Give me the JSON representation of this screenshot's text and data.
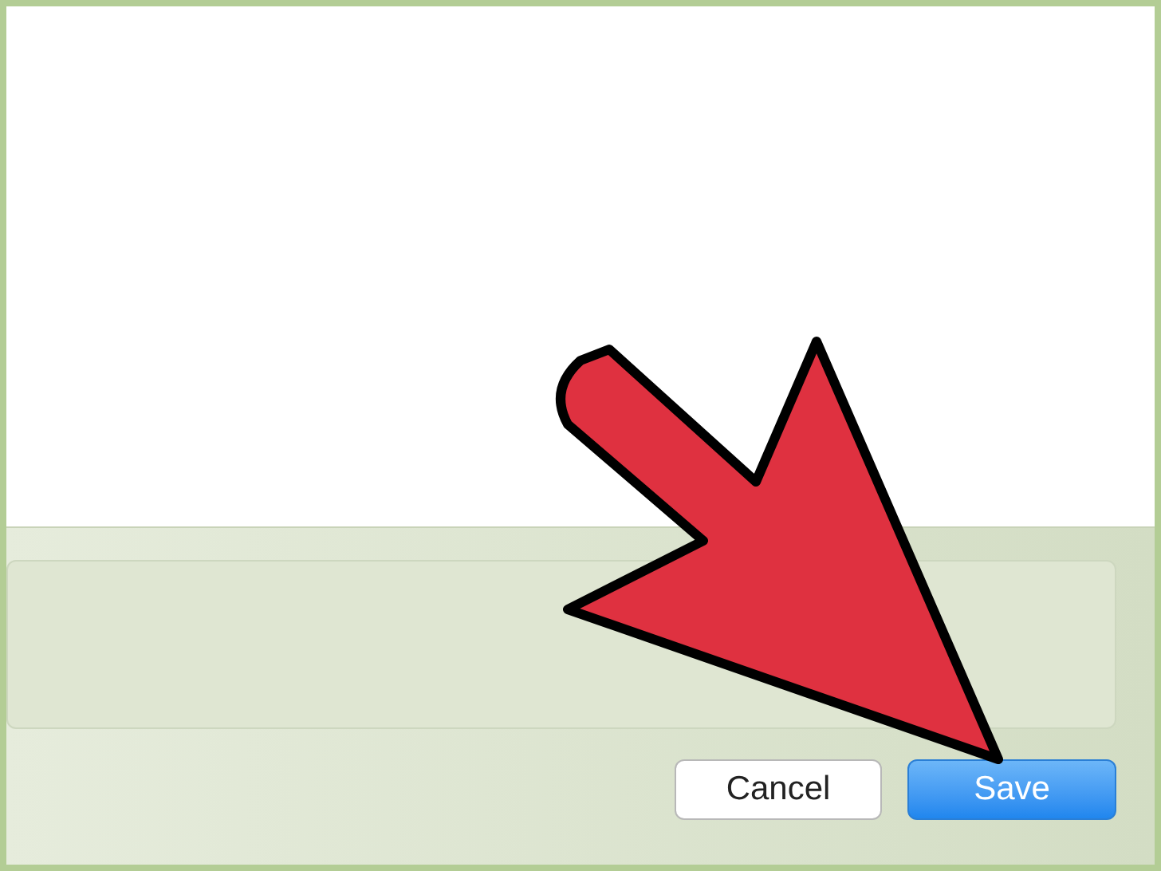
{
  "buttons": [
    {
      "label": "Cancel",
      "kind": "secondary"
    },
    {
      "label": "Save",
      "kind": "primary"
    }
  ]
}
